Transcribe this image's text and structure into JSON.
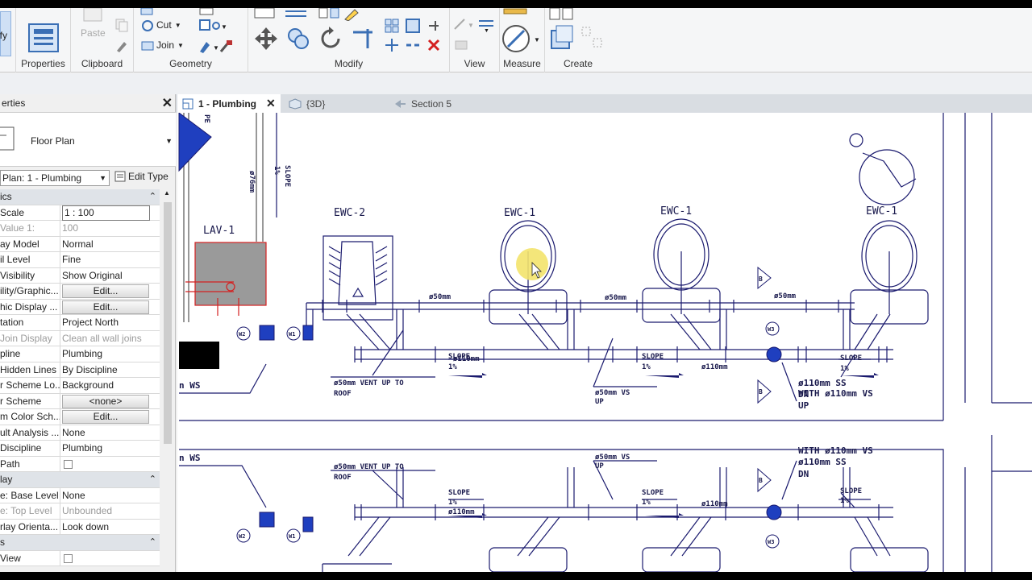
{
  "ribbon": {
    "modify_label": "ify",
    "properties_label": "Properties",
    "paste_label": "Paste",
    "clipboard_label": "Clipboard",
    "cut_label": "Cut",
    "join_label": "Join",
    "geometry_label": "Geometry",
    "modify_group_label": "Modify",
    "view_label": "View",
    "measure_label": "Measure",
    "create_label": "Create"
  },
  "tabs": [
    {
      "label": "1 - Plumbing",
      "active": true
    },
    {
      "label": "{3D}",
      "active": false
    },
    {
      "label": "Section 5",
      "active": false
    }
  ],
  "properties": {
    "header": "erties",
    "type_name": "Floor Plan",
    "instance_selector": "Plan: 1 - Plumbing",
    "edit_type": "Edit Type",
    "rows": [
      {
        "kind": "cat",
        "name": "ics"
      },
      {
        "name": "Scale",
        "value": "1 : 100",
        "style": "box"
      },
      {
        "name": "Value 1:",
        "value": "100",
        "dim": true
      },
      {
        "name": "ay Model",
        "value": "Normal"
      },
      {
        "name": "il Level",
        "value": "Fine"
      },
      {
        "name": "Visibility",
        "value": "Show Original"
      },
      {
        "name": "ility/Graphic...",
        "value": "Edit...",
        "style": "button"
      },
      {
        "name": "hic Display ...",
        "value": "Edit...",
        "style": "button"
      },
      {
        "name": "tation",
        "value": "Project North"
      },
      {
        "name": "Join Display",
        "value": "Clean all wall joins",
        "dim": true
      },
      {
        "name": "pline",
        "value": "Plumbing"
      },
      {
        "name": "Hidden Lines",
        "value": "By Discipline"
      },
      {
        "name": "r Scheme Lo...",
        "value": "Background"
      },
      {
        "name": "r Scheme",
        "value": "<none>",
        "style": "button"
      },
      {
        "name": "m Color Sch...",
        "value": "Edit...",
        "style": "button"
      },
      {
        "name": "ult Analysis ...",
        "value": "None"
      },
      {
        "name": "Discipline",
        "value": "Plumbing"
      },
      {
        "name": "Path",
        "value": "",
        "style": "check"
      },
      {
        "kind": "cat",
        "name": "lay"
      },
      {
        "name": "e: Base Level",
        "value": "None"
      },
      {
        "name": "e: Top Level",
        "value": "Unbounded",
        "dim": true
      },
      {
        "name": "rlay Orienta...",
        "value": "Look down"
      },
      {
        "kind": "cat",
        "name": "s"
      },
      {
        "name": "View",
        "value": "",
        "style": "check"
      }
    ]
  },
  "drawing": {
    "labels": {
      "ewc2": "EWC-2",
      "ewc1a": "EWC-1",
      "ewc1b": "EWC-1",
      "ewc1c": "EWC-1",
      "lav1": "LAV-1",
      "slope_v": "SLOPE",
      "pct_v": "1%",
      "d76": "ø76mm",
      "pe": "PE",
      "d50a": "ø50mm",
      "d50b": "ø50mm",
      "d50c": "ø50mm",
      "slope1": "SLOPE",
      "slope2": "SLOPE",
      "slope3": "SLOPE",
      "pct1": "1%",
      "pct2": "1%",
      "pct3": "1%",
      "d110a": "ø110mm",
      "d110b": "ø110mm",
      "vent1": "ø50mm VENT UP TO",
      "roof1": "ROOF",
      "vs1": "ø50mm VS",
      "up1": "UP",
      "ss1": "ø110mm SS",
      "with1": "WITH ø110mm VS",
      "up2": "UP",
      "dn1": "DN",
      "ws1": "n WS",
      "ws2": "n WS",
      "vent2": "ø50mm VENT UP TO",
      "roof2": "ROOF",
      "vs2": "ø50mm VS",
      "up3": "UP",
      "with2": "WITH ø110mm VS",
      "ss2": "ø110mm SS",
      "dn2": "DN",
      "slope4": "SLOPE",
      "slope5": "SLOPE",
      "slope6": "SLOPE",
      "pct4": "1%",
      "pct5": "1%",
      "pct6": "1%",
      "d110c": "ø110mm",
      "d110d": "ø110mm",
      "w1a": "W1",
      "w2a": "W2",
      "w1b": "W1",
      "w2b": "W2",
      "w3a": "W3",
      "w3b": "W3",
      "ba": "B",
      "bb": "B",
      "bc": "B"
    }
  },
  "colors": {
    "line": "#1a1a6e",
    "selection": "#d42020",
    "accent_blue": "#1f3fbf"
  }
}
